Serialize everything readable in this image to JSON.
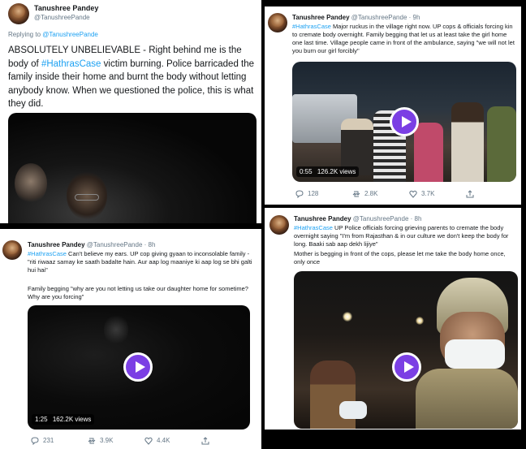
{
  "tweet1": {
    "name": "Tanushree Pandey",
    "handle": "@TanushreePande",
    "replying_prefix": "Replying to",
    "replying_handle": "@TanushreePande",
    "text_before": "ABSOLUTELY UNBELIEVABLE - Right behind me is the body of",
    "hashtag": "#HathrasCase",
    "text_after": "victim burning. Police barricaded the family inside their home and burnt the body without letting anybody know. When we questioned the police, this is what they did."
  },
  "tweet2": {
    "name": "Tanushree Pandey",
    "handle": "@TanushreePande",
    "time": "· 9h",
    "hashtag": "#HathrasCase",
    "text": "Major ruckus in the village right now. UP cops & officials forcing kin to cremate body overnight.  Family begging that let us at least take the girl home one last time. Village people came in front of the ambulance, saying \"we will not let you burn our girl forcibly\"",
    "duration": "0:55",
    "views": "126.2K views",
    "replies": "128",
    "retweets": "2.8K",
    "likes": "3.7K"
  },
  "tweet3": {
    "name": "Tanushree Pandey",
    "handle": "@TanushreePande",
    "time": "· 8h",
    "hashtag": "#HathrasCase",
    "text1": "Can't believe my ears. UP cop giving gyaan to inconsolable family - \"riti riwaaz samay ke saath badalte hain. Aur aap log maaniye ki aap log se bhi galti hui hai\"",
    "text2": "Family begging \"why are you not letting us take our daughter home for sometime? Why are you forcing\"",
    "duration": "1:25",
    "views": "162.2K views",
    "replies": "231",
    "retweets": "3.9K",
    "likes": "4.4K"
  },
  "tweet4": {
    "name": "Tanushree Pandey",
    "handle": "@TanushreePande",
    "time": "· 8h",
    "hashtag": "#HathrasCase",
    "text1": "UP Police officials forcing grieving parents to cremate the body overnight saying \"I'm from Rajasthan & in our culture we don't keep the body for long. Baaki sab aap dekh lijiye\"",
    "text2": "Mother is begging in front of the cops, please let me take the body home once, only once"
  },
  "colors": {
    "link": "#1da1f2",
    "play_button": "#7b3fe4",
    "muted": "#657786"
  }
}
